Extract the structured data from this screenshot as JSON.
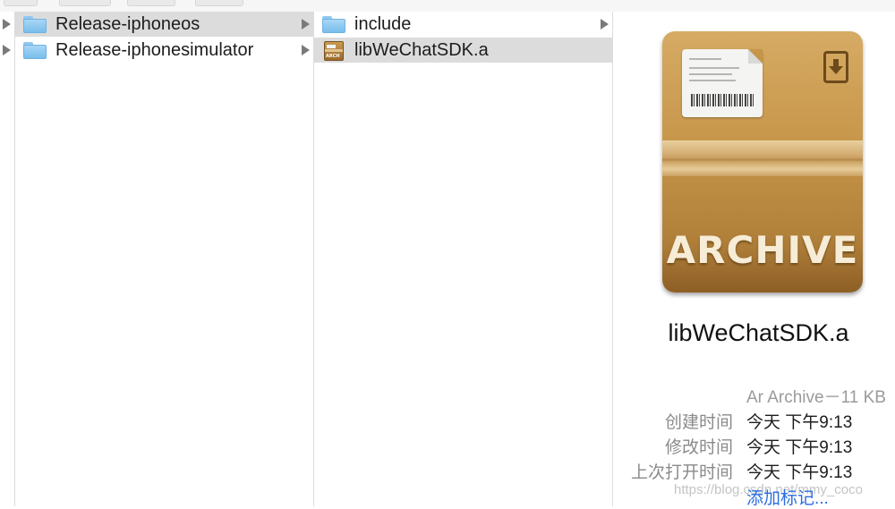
{
  "column1": {
    "items": [
      {
        "label": "Release-iphoneos",
        "icon": "folder-icon",
        "selected": true,
        "has_children": true
      },
      {
        "label": "Release-iphonesimulator",
        "icon": "folder-icon",
        "selected": false,
        "has_children": true
      }
    ]
  },
  "column2": {
    "items": [
      {
        "label": "include",
        "icon": "folder-icon",
        "selected": false,
        "has_children": true
      },
      {
        "label": "libWeChatSDK.a",
        "icon": "archive-icon",
        "selected": true,
        "has_children": false
      }
    ]
  },
  "preview": {
    "icon_text": "ARCHIVE",
    "file_name": "libWeChatSDK.a",
    "kind_size": "Ar Archive－11 KB",
    "info": [
      {
        "key": "创建时间",
        "value": "今天 下午9:13"
      },
      {
        "key": "修改时间",
        "value": "今天 下午9:13"
      },
      {
        "key": "上次打开时间",
        "value": "今天 下午9:13"
      }
    ],
    "add_tags": "添加标记...",
    "watermark": "https://blog.csdn.net/mmy_coco"
  },
  "colors": {
    "selection": "#dcdcdc",
    "folder": "#8fc8f0",
    "link": "#2a6ee0"
  }
}
